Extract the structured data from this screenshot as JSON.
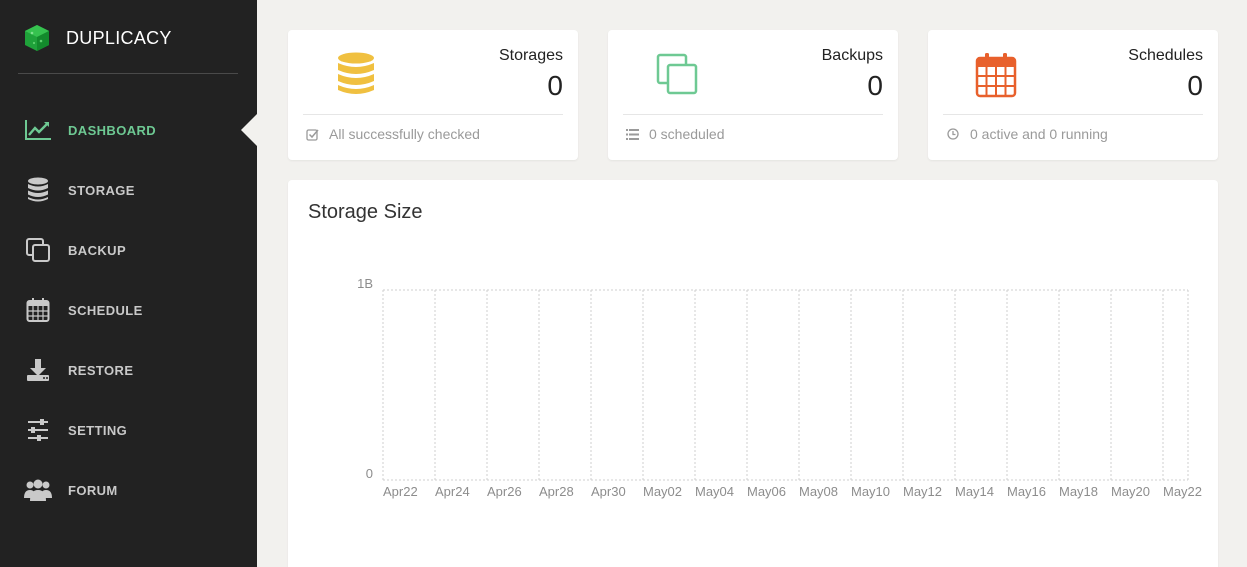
{
  "app": {
    "name": "DUPLICACY"
  },
  "sidebar": {
    "items": [
      {
        "label": "DASHBOARD",
        "icon": "line-chart-icon",
        "active": true
      },
      {
        "label": "STORAGE",
        "icon": "database-icon",
        "active": false
      },
      {
        "label": "BACKUP",
        "icon": "copy-icon",
        "active": false
      },
      {
        "label": "SCHEDULE",
        "icon": "calendar-icon",
        "active": false
      },
      {
        "label": "RESTORE",
        "icon": "download-icon",
        "active": false
      },
      {
        "label": "SETTING",
        "icon": "sliders-icon",
        "active": false
      },
      {
        "label": "FORUM",
        "icon": "users-icon",
        "active": false
      }
    ]
  },
  "cards": {
    "storages": {
      "title": "Storages",
      "value": "0",
      "footer": "All successfully checked",
      "icon": "database-icon",
      "color": "#f0c040"
    },
    "backups": {
      "title": "Backups",
      "value": "0",
      "footer": "0 scheduled",
      "icon": "copy-icon",
      "color": "#6ec993"
    },
    "schedules": {
      "title": "Schedules",
      "value": "0",
      "footer": "0 active and 0 running",
      "icon": "calendar-icon",
      "color": "#e8602c"
    }
  },
  "colors": {
    "accent": "#6ec993",
    "sidebar": "#222222",
    "background": "#f2f1ee"
  },
  "chart_data": {
    "type": "line",
    "title": "Storage Size",
    "xlabel": "",
    "ylabel": "",
    "x": [
      "Apr22",
      "Apr24",
      "Apr26",
      "Apr28",
      "Apr30",
      "May02",
      "May04",
      "May06",
      "May08",
      "May10",
      "May12",
      "May14",
      "May16",
      "May18",
      "May20",
      "May22"
    ],
    "y_ticks": [
      "0",
      "1B"
    ],
    "ylim": [
      0,
      1
    ],
    "series": [],
    "grid": true
  }
}
